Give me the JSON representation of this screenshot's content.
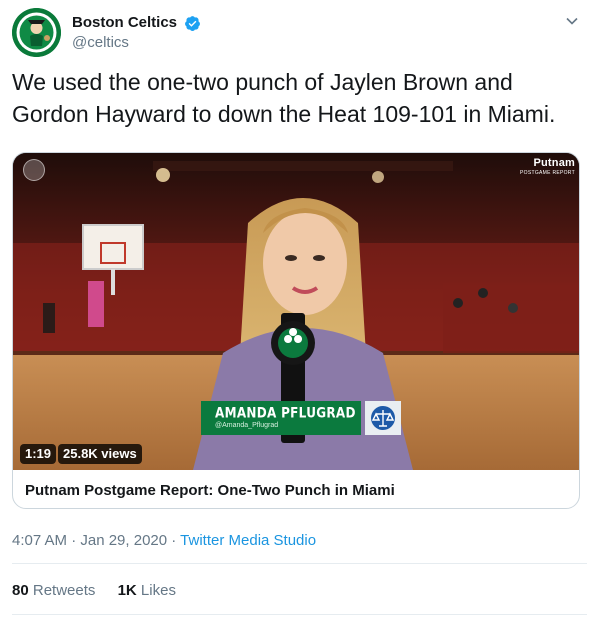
{
  "author": {
    "display_name": "Boston Celtics",
    "handle": "@celtics",
    "verified": true,
    "avatar_icon": "celtics-logo-icon"
  },
  "tweet": {
    "text": "We used the one-two punch of Jaylen Brown and Gordon Hayward to down the Heat 109-101 in Miami."
  },
  "video": {
    "brand": "Putnam",
    "brand_sub": "POSTGAME REPORT",
    "reporter_name": "AMANDA PFLUGRAD",
    "reporter_handle": "@Amanda_Pflugrad",
    "duration": "1:19",
    "views": "25.8K views",
    "title": "Putnam Postgame Report: One-Two Punch in Miami"
  },
  "meta": {
    "timestamp": "4:07 AM · Jan 29, 2020",
    "separator": " · ",
    "source": "Twitter Media Studio"
  },
  "stats": {
    "retweets_count": "80",
    "retweets_label": "Retweets",
    "likes_count": "1K",
    "likes_label": "Likes"
  },
  "colors": {
    "link": "#1b95e0",
    "celtics_green": "#0b7a3e",
    "muted": "#657786"
  }
}
